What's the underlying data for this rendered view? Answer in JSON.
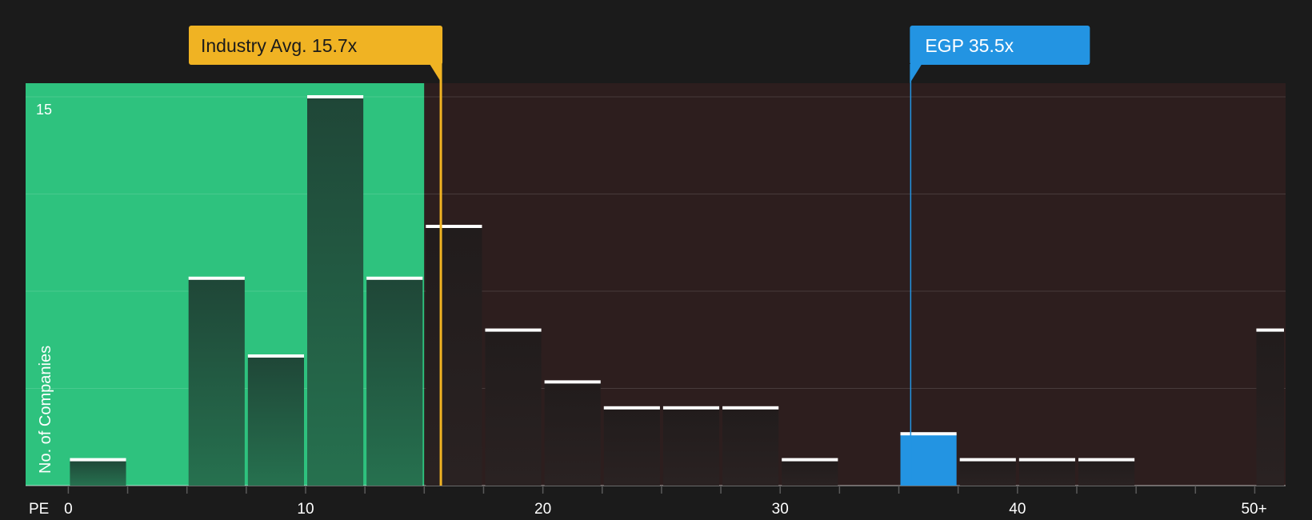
{
  "chart_data": {
    "type": "bar",
    "x_axis_label": "PE",
    "y_axis_label": "No. of Companies",
    "y_tick_labels": [
      {
        "value": 15,
        "label": "15"
      }
    ],
    "ylim": [
      0,
      15
    ],
    "x_ticks": [
      {
        "value": 0,
        "label": "0"
      },
      {
        "value": 10,
        "label": "10"
      },
      {
        "value": 20,
        "label": "20"
      },
      {
        "value": 30,
        "label": "30"
      },
      {
        "value": 40,
        "label": "40"
      },
      {
        "value": 50,
        "label": "50+"
      }
    ],
    "xlim": [
      -1.8,
      51.3
    ],
    "bin_width": 2.5,
    "bins": [
      {
        "x0": 0,
        "x1": 2.5,
        "value": 1
      },
      {
        "x0": 2.5,
        "x1": 5,
        "value": 0
      },
      {
        "x0": 5,
        "x1": 7.5,
        "value": 8
      },
      {
        "x0": 7.5,
        "x1": 10,
        "value": 5
      },
      {
        "x0": 10,
        "x1": 12.5,
        "value": 15
      },
      {
        "x0": 12.5,
        "x1": 15,
        "value": 8
      },
      {
        "x0": 15,
        "x1": 17.5,
        "value": 10
      },
      {
        "x0": 17.5,
        "x1": 20,
        "value": 6
      },
      {
        "x0": 20,
        "x1": 22.5,
        "value": 4
      },
      {
        "x0": 22.5,
        "x1": 25,
        "value": 3
      },
      {
        "x0": 25,
        "x1": 27.5,
        "value": 3
      },
      {
        "x0": 27.5,
        "x1": 30,
        "value": 3
      },
      {
        "x0": 30,
        "x1": 32.5,
        "value": 1
      },
      {
        "x0": 32.5,
        "x1": 35,
        "value": 0
      },
      {
        "x0": 35,
        "x1": 37.5,
        "value": 2,
        "highlight": true
      },
      {
        "x0": 37.5,
        "x1": 40,
        "value": 1
      },
      {
        "x0": 40,
        "x1": 42.5,
        "value": 1
      },
      {
        "x0": 42.5,
        "x1": 45,
        "value": 1
      },
      {
        "x0": 45,
        "x1": 47.5,
        "value": 0
      },
      {
        "x0": 47.5,
        "x1": 50,
        "value": 0
      },
      {
        "x0": 50,
        "x1": 52.5,
        "value": 6
      }
    ],
    "undervalued_zone_end": 15,
    "markers": [
      {
        "name": "industry",
        "label": "Industry Avg. 15.7x",
        "value": 15.7,
        "color": "#f0b323"
      },
      {
        "name": "company",
        "label": "EGP 35.5x",
        "value": 35.5,
        "color": "#2394e2"
      }
    ],
    "colors": {
      "background": "#1b1b1b",
      "good_zone": "#2ec27e",
      "bad_zone": "#2d1e1e",
      "bar_in_good": "#1f4a38",
      "bar_default": "#231d1d",
      "bar_highlight": "#2394e2",
      "bar_cap": "#ffffff",
      "text": "#ffffff"
    }
  }
}
